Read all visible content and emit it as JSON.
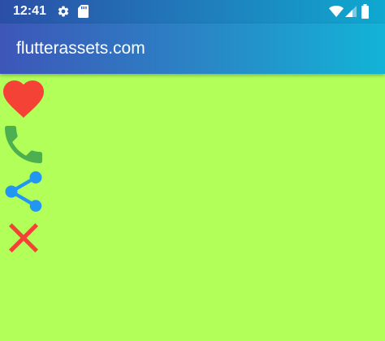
{
  "status_bar": {
    "time": "12:41",
    "left_icons": [
      "settings-icon",
      "sd-card-icon"
    ],
    "right_icons": [
      "wifi-icon",
      "signal-icon",
      "battery-icon"
    ]
  },
  "app_bar": {
    "title": "flutterassets.com"
  },
  "icons": [
    {
      "name": "heart-icon",
      "color": "#f44336"
    },
    {
      "name": "phone-icon",
      "color": "#4caf50"
    },
    {
      "name": "share-icon",
      "color": "#2196f3"
    },
    {
      "name": "close-icon",
      "color": "#f44336"
    }
  ],
  "colors": {
    "background": "#b2ff59",
    "app_bar_start": "#3d56b8",
    "app_bar_end": "#12b4d6",
    "status_text": "#ffffff"
  }
}
